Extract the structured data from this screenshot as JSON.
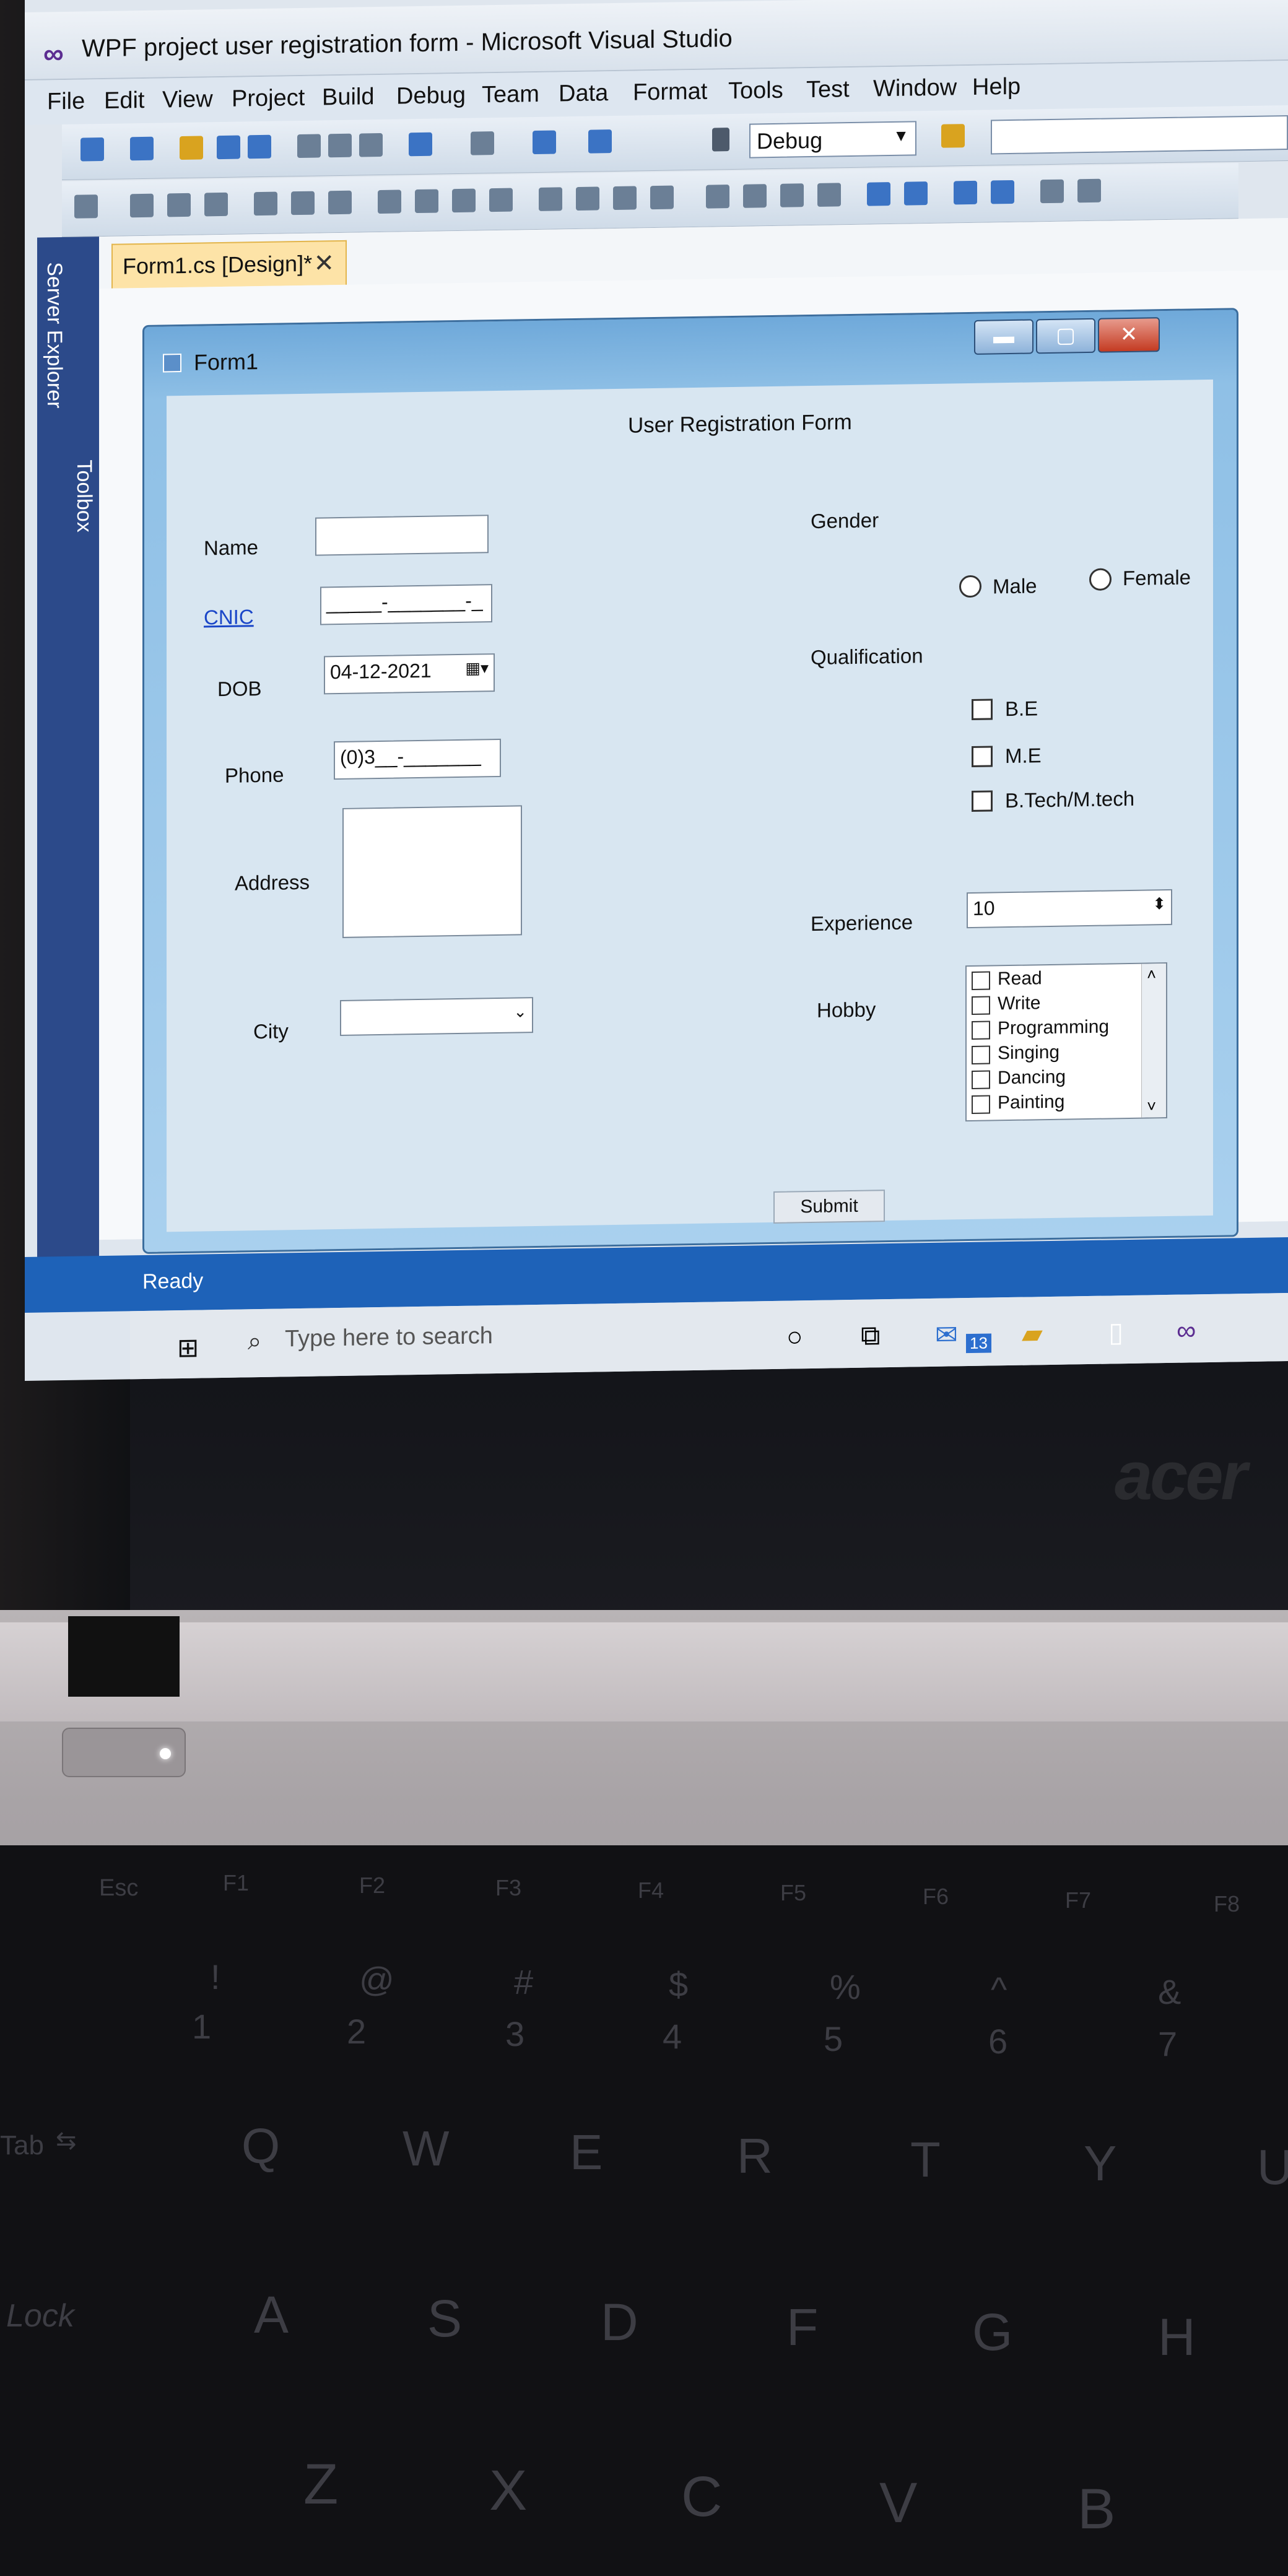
{
  "window": {
    "title": "WPF project user registration form - Microsoft Visual Studio"
  },
  "menu": [
    "File",
    "Edit",
    "View",
    "Project",
    "Build",
    "Debug",
    "Team",
    "Data",
    "Format",
    "Tools",
    "Test",
    "Window",
    "Help"
  ],
  "toolbar": {
    "config": "Debug"
  },
  "dock": {
    "server_explorer": "Server Explorer",
    "toolbox": "Toolbox"
  },
  "tab": {
    "label": "Form1.cs [Design]*",
    "close": "✕"
  },
  "form": {
    "title": "Form1",
    "heading": "User Registration Form",
    "name_label": "Name",
    "cnic_label": "CNIC",
    "cnic_mask": "_____-_______-_",
    "dob_label": "DOB",
    "dob_value": "04-12-2021",
    "phone_label": "Phone",
    "phone_mask": "(0)3__-_______",
    "address_label": "Address",
    "city_label": "City",
    "gender_label": "Gender",
    "male": "Male",
    "female": "Female",
    "qualification_label": "Qualification",
    "qualifications": [
      "B.E",
      "M.E",
      "B.Tech/M.tech"
    ],
    "experience_label": "Experience",
    "experience_value": "10",
    "hobby_label": "Hobby",
    "hobbies": [
      "Read",
      "Write",
      "Programming",
      "Singing",
      "Dancing",
      "Painting"
    ],
    "submit": "Submit"
  },
  "status": {
    "text": "Ready"
  },
  "taskbar": {
    "search_placeholder": "Type here to search",
    "mail_badge": "13"
  },
  "laptop": {
    "brand": "acer",
    "fn_keys": [
      "Esc",
      "F1",
      "F2",
      "F3",
      "F4",
      "F5",
      "F6",
      "F7",
      "F8"
    ],
    "num_row": [
      {
        "top": "!",
        "bottom": "1"
      },
      {
        "top": "@",
        "bottom": "2"
      },
      {
        "top": "#",
        "bottom": "3"
      },
      {
        "top": "$",
        "bottom": "4"
      },
      {
        "top": "%",
        "bottom": "5"
      },
      {
        "top": "^",
        "bottom": "6"
      },
      {
        "top": "&",
        "bottom": "7"
      }
    ],
    "tab": "Tab",
    "row_q": [
      "Q",
      "W",
      "E",
      "R",
      "T",
      "Y",
      "U"
    ],
    "lock": "Lock",
    "row_a": [
      "A",
      "S",
      "D",
      "F",
      "G",
      "H"
    ],
    "row_z": [
      "Z",
      "X",
      "C",
      "V",
      "B"
    ]
  }
}
